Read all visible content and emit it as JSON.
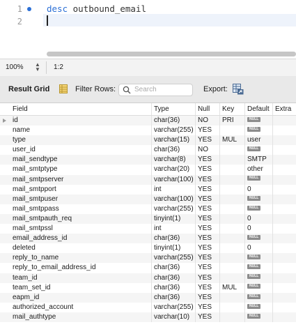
{
  "editor": {
    "line_numbers": [
      "1",
      "2"
    ],
    "keyword": "desc",
    "code_rest": " outbound_email"
  },
  "status": {
    "zoom": "100%",
    "position": "1:2"
  },
  "toolbar": {
    "result_grid_label": "Result Grid",
    "filter_rows_label": "Filter Rows:",
    "search_placeholder": "Search",
    "export_label": "Export:"
  },
  "grid": {
    "columns": [
      "Field",
      "Type",
      "Null",
      "Key",
      "Default",
      "Extra"
    ],
    "null_badge": "NULL",
    "rows": [
      [
        "id",
        "char(36)",
        "NO",
        "PRI",
        "NULL",
        ""
      ],
      [
        "name",
        "varchar(255)",
        "YES",
        "",
        "NULL",
        ""
      ],
      [
        "type",
        "varchar(15)",
        "YES",
        "MUL",
        "user",
        ""
      ],
      [
        "user_id",
        "char(36)",
        "NO",
        "",
        "NULL",
        ""
      ],
      [
        "mail_sendtype",
        "varchar(8)",
        "YES",
        "",
        "SMTP",
        ""
      ],
      [
        "mail_smtptype",
        "varchar(20)",
        "YES",
        "",
        "other",
        ""
      ],
      [
        "mail_smtpserver",
        "varchar(100)",
        "YES",
        "",
        "NULL",
        ""
      ],
      [
        "mail_smtpport",
        "int",
        "YES",
        "",
        "0",
        ""
      ],
      [
        "mail_smtpuser",
        "varchar(100)",
        "YES",
        "",
        "NULL",
        ""
      ],
      [
        "mail_smtppass",
        "varchar(255)",
        "YES",
        "",
        "NULL",
        ""
      ],
      [
        "mail_smtpauth_req",
        "tinyint(1)",
        "YES",
        "",
        "0",
        ""
      ],
      [
        "mail_smtpssl",
        "int",
        "YES",
        "",
        "0",
        ""
      ],
      [
        "email_address_id",
        "char(36)",
        "YES",
        "",
        "NULL",
        ""
      ],
      [
        "deleted",
        "tinyint(1)",
        "YES",
        "",
        "0",
        ""
      ],
      [
        "reply_to_name",
        "varchar(255)",
        "YES",
        "",
        "NULL",
        ""
      ],
      [
        "reply_to_email_address_id",
        "char(36)",
        "YES",
        "",
        "NULL",
        ""
      ],
      [
        "team_id",
        "char(36)",
        "YES",
        "",
        "NULL",
        ""
      ],
      [
        "team_set_id",
        "char(36)",
        "YES",
        "MUL",
        "NULL",
        ""
      ],
      [
        "eapm_id",
        "char(36)",
        "YES",
        "",
        "NULL",
        ""
      ],
      [
        "authorized_account",
        "varchar(255)",
        "YES",
        "",
        "NULL",
        ""
      ],
      [
        "mail_authtype",
        "varchar(10)",
        "YES",
        "",
        "NULL",
        ""
      ]
    ]
  }
}
